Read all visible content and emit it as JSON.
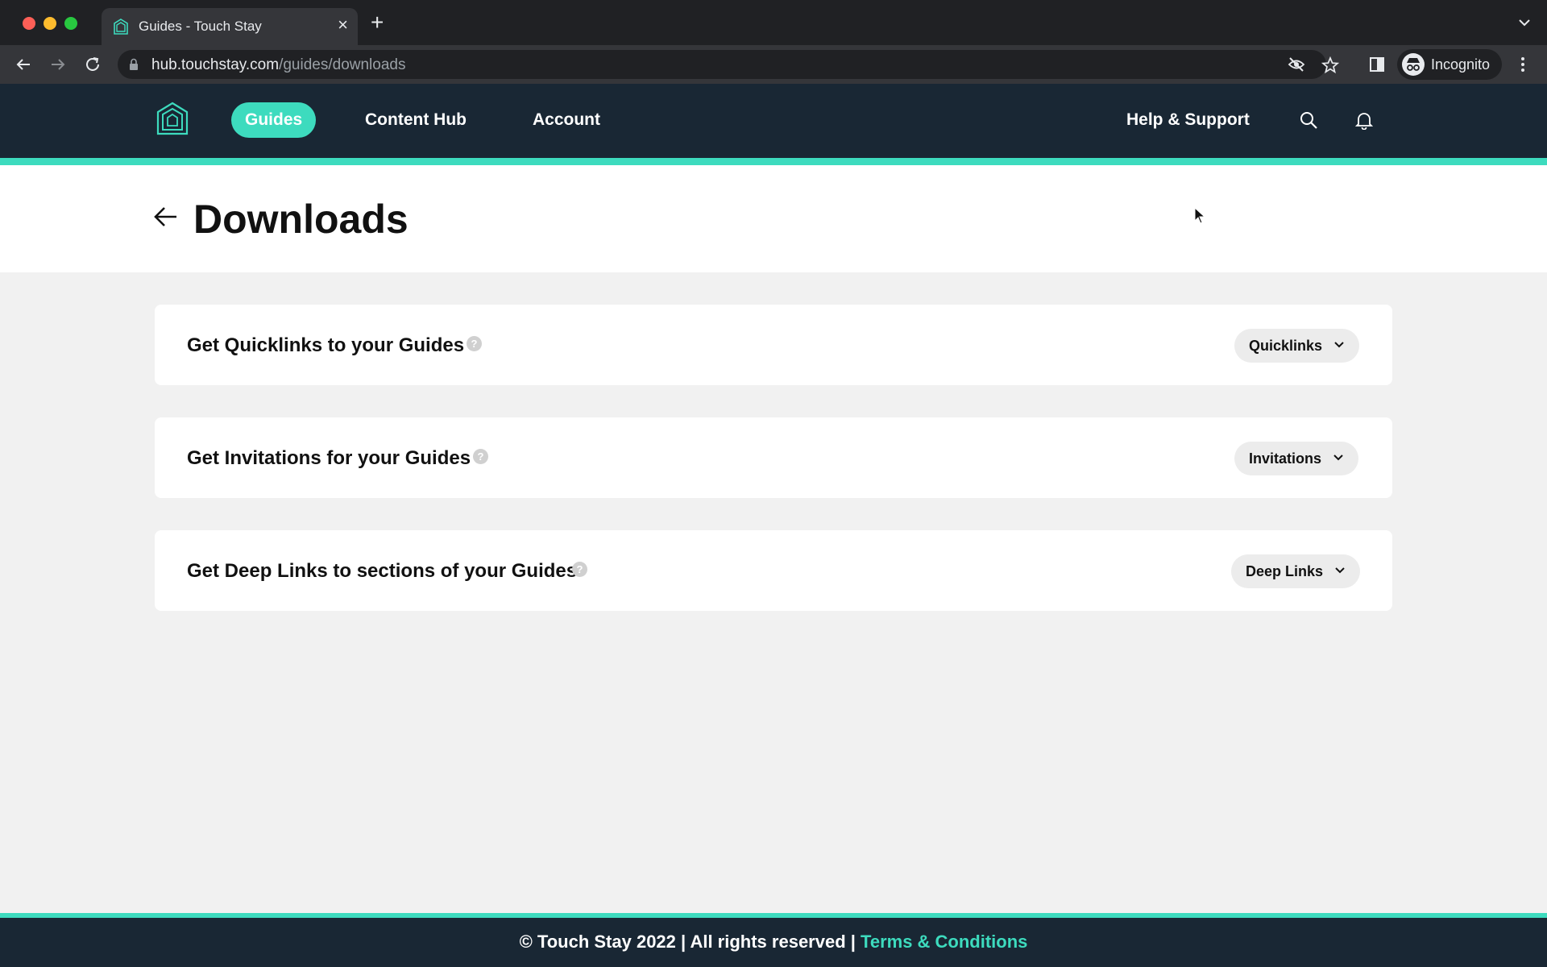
{
  "browser": {
    "tab_title": "Guides - Touch Stay",
    "tab_close": "×",
    "new_tab": "+",
    "url_host": "hub.touchstay.com",
    "url_path": "/guides/downloads",
    "profile_label": "Incognito"
  },
  "header": {
    "nav": {
      "guides": "Guides",
      "content_hub": "Content Hub",
      "account": "Account"
    },
    "help_support": "Help & Support",
    "accent_color": "#3ddbbe",
    "bg_color": "#192734"
  },
  "page": {
    "title": "Downloads"
  },
  "cards": [
    {
      "title": "Get Quicklinks to your Guides",
      "help": "?",
      "dropdown": "Quicklinks"
    },
    {
      "title": "Get Invitations for your Guides",
      "help": "?",
      "dropdown": "Invitations"
    },
    {
      "title": "Get Deep Links to sections of your Guides",
      "help": "?",
      "dropdown": "Deep Links"
    }
  ],
  "footer": {
    "copyright": "© Touch Stay 2022 | All rights reserved | ",
    "terms_link": "Terms & Conditions"
  }
}
